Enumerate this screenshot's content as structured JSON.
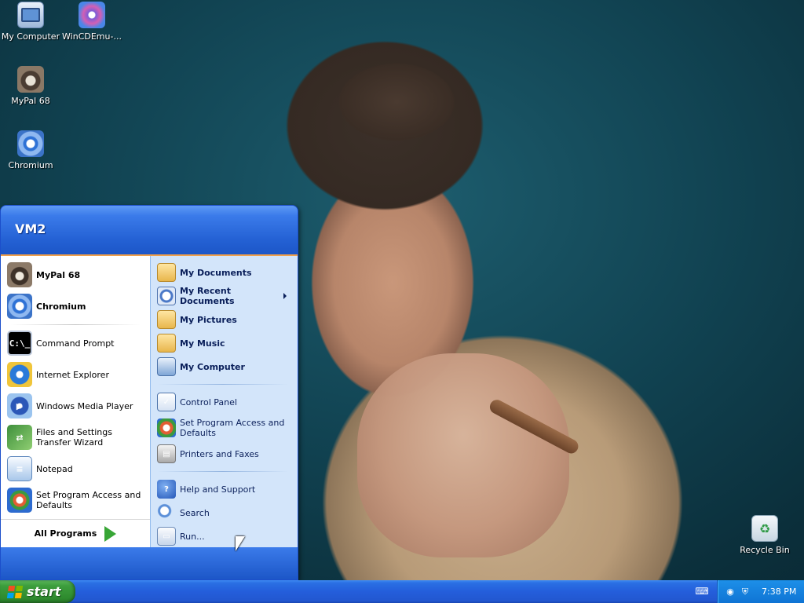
{
  "desktop": {
    "icons": [
      {
        "name": "my-computer",
        "label": "My Computer",
        "icon": "computer-icon"
      },
      {
        "name": "wincdemu",
        "label": "WinCDEmu-...",
        "icon": "disc-icon"
      },
      {
        "name": "mypal",
        "label": "MyPal 68",
        "icon": "raccoon-icon"
      },
      {
        "name": "chromium",
        "label": "Chromium",
        "icon": "chromium-icon"
      },
      {
        "name": "recycle-bin",
        "label": "Recycle Bin",
        "icon": "recycle-bin-icon"
      }
    ]
  },
  "start_menu": {
    "user": "VM2",
    "pinned": [
      {
        "label": "MyPal 68",
        "icon": "raccoon-icon"
      },
      {
        "label": "Chromium",
        "icon": "chromium-icon"
      }
    ],
    "recent": [
      {
        "label": "Command Prompt",
        "icon": "command-prompt-icon",
        "glyph": "C:\\_"
      },
      {
        "label": "Internet Explorer",
        "icon": "internet-explorer-icon",
        "glyph": "e"
      },
      {
        "label": "Windows Media Player",
        "icon": "media-player-icon",
        "glyph": "▶"
      },
      {
        "label": "Files and Settings Transfer Wizard",
        "icon": "transfer-wizard-icon",
        "glyph": "⇄"
      },
      {
        "label": "Notepad",
        "icon": "notepad-icon",
        "glyph": "≡"
      },
      {
        "label": "Set Program Access and Defaults",
        "icon": "program-access-icon",
        "glyph": ""
      }
    ],
    "all_programs": "All Programs",
    "places": [
      {
        "label": "My Documents",
        "icon": "folder-documents-icon"
      },
      {
        "label": "My Recent Documents",
        "icon": "recent-documents-icon"
      },
      {
        "label": "My Pictures",
        "icon": "folder-pictures-icon"
      },
      {
        "label": "My Music",
        "icon": "folder-music-icon"
      },
      {
        "label": "My Computer",
        "icon": "computer-icon"
      }
    ],
    "settings": [
      {
        "label": "Control Panel",
        "icon": "control-panel-icon",
        "glyph": "✓"
      },
      {
        "label": "Set Program Access and Defaults",
        "icon": "program-access-icon",
        "glyph": ""
      },
      {
        "label": "Printers and Faxes",
        "icon": "printer-icon",
        "glyph": "▤"
      }
    ],
    "tools": [
      {
        "label": "Help and Support",
        "icon": "help-icon",
        "glyph": "?"
      },
      {
        "label": "Search",
        "icon": "search-icon",
        "glyph": ""
      },
      {
        "label": "Run...",
        "icon": "run-icon",
        "glyph": "▭"
      }
    ]
  },
  "taskbar": {
    "start_label": "start",
    "clock": "7:38 PM",
    "tray_icons": [
      "network-icon",
      "security-icon"
    ]
  }
}
